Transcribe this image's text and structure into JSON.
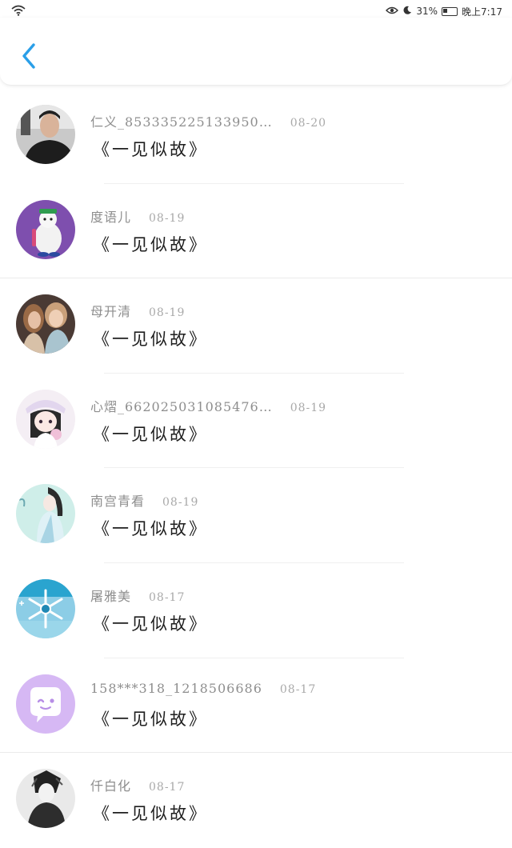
{
  "status_bar": {
    "battery": "31%",
    "time": "晚上7:17"
  },
  "header": {
    "back_icon": "chevron-left-icon",
    "accent": "#2a9fe8"
  },
  "items": [
    {
      "name": "仁义_853335225133950…",
      "date": "08-20",
      "comment": "《一见似故》",
      "avatar": "photo-man"
    },
    {
      "name": "度语儿",
      "date": "08-19",
      "comment": "《一见似故》",
      "avatar": "cartoon-purple"
    },
    {
      "name": "母开清",
      "date": "08-19",
      "comment": "《一见似故》",
      "avatar": "photo-girls"
    },
    {
      "name": "心熠_662025031085476…",
      "date": "08-19",
      "comment": "《一见似故》",
      "avatar": "anime-girl"
    },
    {
      "name": "南宫青看",
      "date": "08-19",
      "comment": "《一见似故》",
      "avatar": "anime-swordsman"
    },
    {
      "name": "屠雅美",
      "date": "08-17",
      "comment": "《一见似故》",
      "avatar": "snowflake"
    },
    {
      "name": "158***318_1218506686",
      "date": "08-17",
      "comment": "《一见似故》",
      "avatar": "default-chat"
    },
    {
      "name": "仟白化",
      "date": "08-17",
      "comment": "《一见似故》",
      "avatar": "anime-boy"
    }
  ]
}
